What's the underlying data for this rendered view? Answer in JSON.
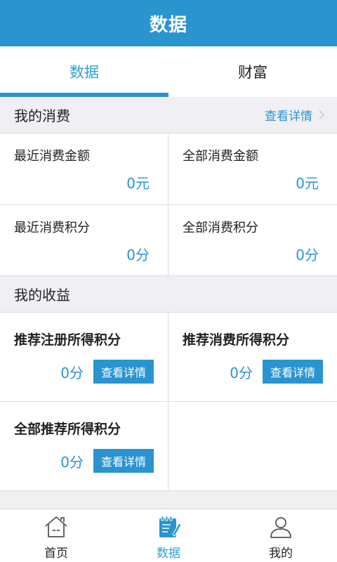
{
  "header": {
    "title": "数据"
  },
  "tabs": [
    {
      "label": "数据"
    },
    {
      "label": "财富"
    }
  ],
  "consumption": {
    "title": "我的消费",
    "detail_link": "查看详情",
    "cells": [
      {
        "label": "最近消费金额",
        "value": "0元"
      },
      {
        "label": "全部消费金额",
        "value": "0元"
      },
      {
        "label": "最近消费积分",
        "value": "0分"
      },
      {
        "label": "全部消费积分",
        "value": "0分"
      }
    ]
  },
  "earnings": {
    "title": "我的收益",
    "cells": [
      {
        "label": "推荐注册所得积分",
        "value": "0分",
        "button": "查看详情"
      },
      {
        "label": "推荐消费所得积分",
        "value": "0分",
        "button": "查看详情"
      },
      {
        "label": "全部推荐所得积分",
        "value": "0分",
        "button": "查看详情"
      }
    ]
  },
  "bottom_nav": [
    {
      "label": "首页",
      "icon": "home-icon"
    },
    {
      "label": "数据",
      "icon": "notepad-icon"
    },
    {
      "label": "我的",
      "icon": "user-icon"
    }
  ],
  "colors": {
    "accent": "#2a94cf",
    "text_active": "#2ba3d8",
    "section_bg": "#efeff4"
  }
}
